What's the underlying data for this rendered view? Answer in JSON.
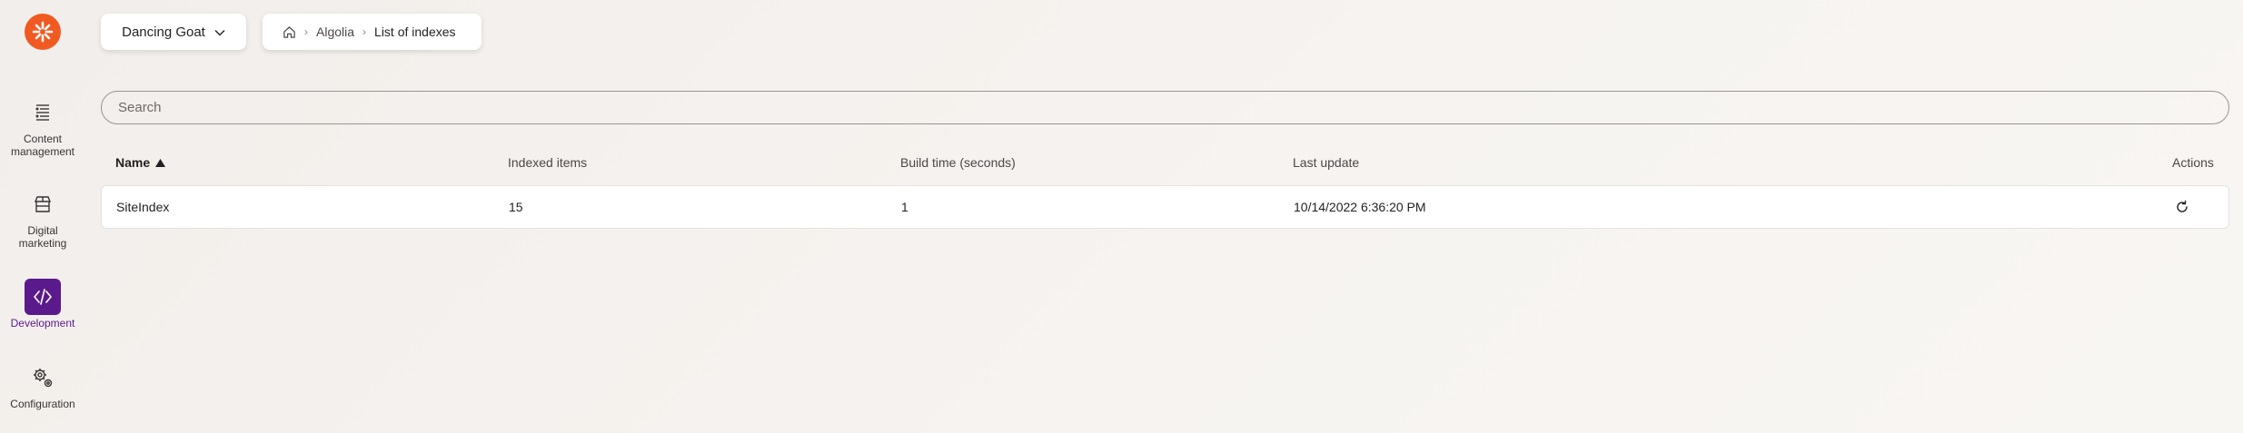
{
  "app": {
    "logo_icon": "kentico-logo-icon",
    "brand_color": "#f05a22",
    "accent_color": "#5b1a8c"
  },
  "rail": {
    "items": [
      {
        "label_line1": "Content",
        "label_line2": "management",
        "icon": "content-list-icon",
        "active": false
      },
      {
        "label_line1": "Digital",
        "label_line2": "marketing",
        "icon": "store-icon",
        "active": false
      },
      {
        "label_line1": "Development",
        "label_line2": "",
        "icon": "code-icon",
        "active": true
      },
      {
        "label_line1": "Configuration",
        "label_line2": "",
        "icon": "gears-icon",
        "active": false
      }
    ]
  },
  "header": {
    "site_name": "Dancing Goat",
    "breadcrumb": {
      "home_icon": "home-icon",
      "items": [
        "Algolia",
        "List of indexes"
      ]
    }
  },
  "search": {
    "placeholder": "Search",
    "value": ""
  },
  "table": {
    "columns": [
      "Name",
      "Indexed items",
      "Build time (seconds)",
      "Last update",
      "Actions"
    ],
    "sort": {
      "column": "Name",
      "direction": "ascending"
    },
    "rows": [
      {
        "name": "SiteIndex",
        "indexed_items": "15",
        "build_time": "1",
        "last_update": "10/14/2022 6:36:20 PM",
        "action_icon": "refresh-icon"
      }
    ]
  }
}
